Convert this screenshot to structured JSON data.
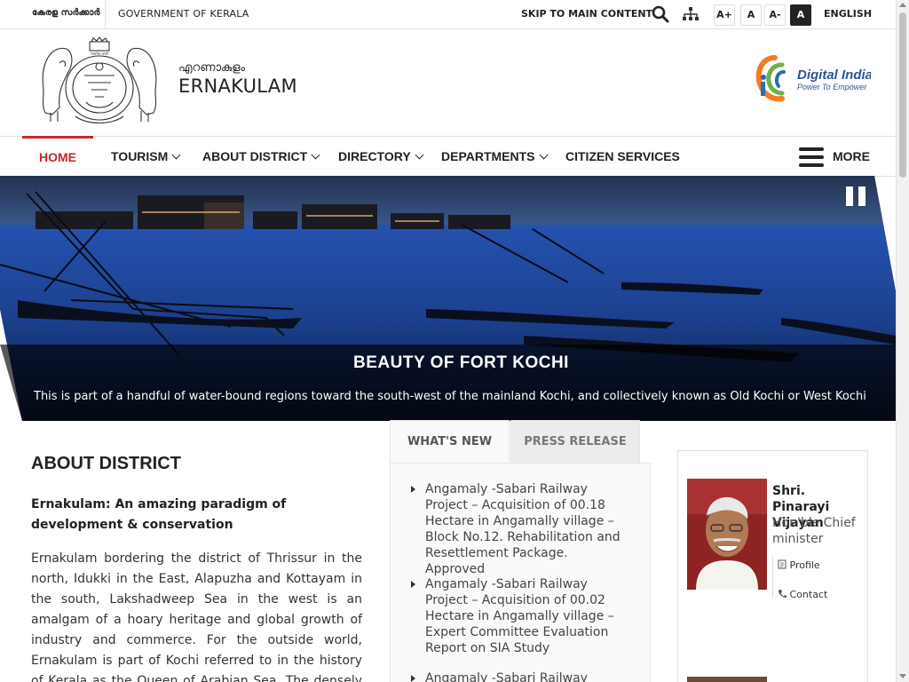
{
  "topbar": {
    "state_ml": "കേരള സർക്കാർ",
    "government": "GOVERNMENT OF KERALA",
    "skip": "SKIP TO MAIN CONTENT",
    "font_buttons": [
      "A+",
      "A",
      "A-",
      "A"
    ],
    "language": "ENGLISH"
  },
  "header": {
    "site_name_ml": "എറണാകുളം",
    "site_name": "ERNAKULAM",
    "digital_india_title": "Digital India",
    "digital_india_tagline": "Power To Empower"
  },
  "nav": {
    "items": [
      {
        "label": "HOME",
        "active": true,
        "dropdown": false
      },
      {
        "label": "TOURISM",
        "active": false,
        "dropdown": true
      },
      {
        "label": "ABOUT DISTRICT",
        "active": false,
        "dropdown": true
      },
      {
        "label": "DIRECTORY",
        "active": false,
        "dropdown": true
      },
      {
        "label": "DEPARTMENTS",
        "active": false,
        "dropdown": true
      },
      {
        "label": "CITIZEN SERVICES",
        "active": false,
        "dropdown": false
      }
    ],
    "more": "MORE",
    "active_color": "#c62828"
  },
  "hero": {
    "title": "BEAUTY OF FORT KOCHI",
    "text": "This is part of a handful of water-bound regions toward the south-west of the mainland Kochi, and collectively known as Old Kochi or West Kochi"
  },
  "about": {
    "heading": "ABOUT DISTRICT",
    "subheading": "Ernakulam: An amazing paradigm of development & conservation",
    "body": "Ernakulam bordering the district of Thrissur in the north, Idukki in the East, Alapuzha and Kottayam in the south, Lakshadweep Sea in the west is an amalgam of a hoary heritage and global growth of industry and commerce. For the outside world, Ernakulam is part of Kochi referred to in the history of Kerala as the Queen of Arabian Sea. The densely populated Ernakulam"
  },
  "tabs": {
    "items": [
      "WHAT'S NEW",
      "PRESS RELEASE"
    ],
    "news": [
      "Angamaly -Sabari Railway Project – Acquisition of 00.18 Hectare in Angamally village – Block No.12. Rehabilitation and Resettlement Package. Approved",
      "Angamaly -Sabari Railway Project – Acquisition of 00.02 Hectare in Angamally village – Expert Committee Evaluation Report on SIA Study",
      "Angamaly -Sabari Railway Project"
    ]
  },
  "cm": {
    "name": "Shri. Pinarayi Vijayan",
    "role": "Hon'ble Chief minister",
    "profile": "Profile",
    "contact": "Contact"
  }
}
